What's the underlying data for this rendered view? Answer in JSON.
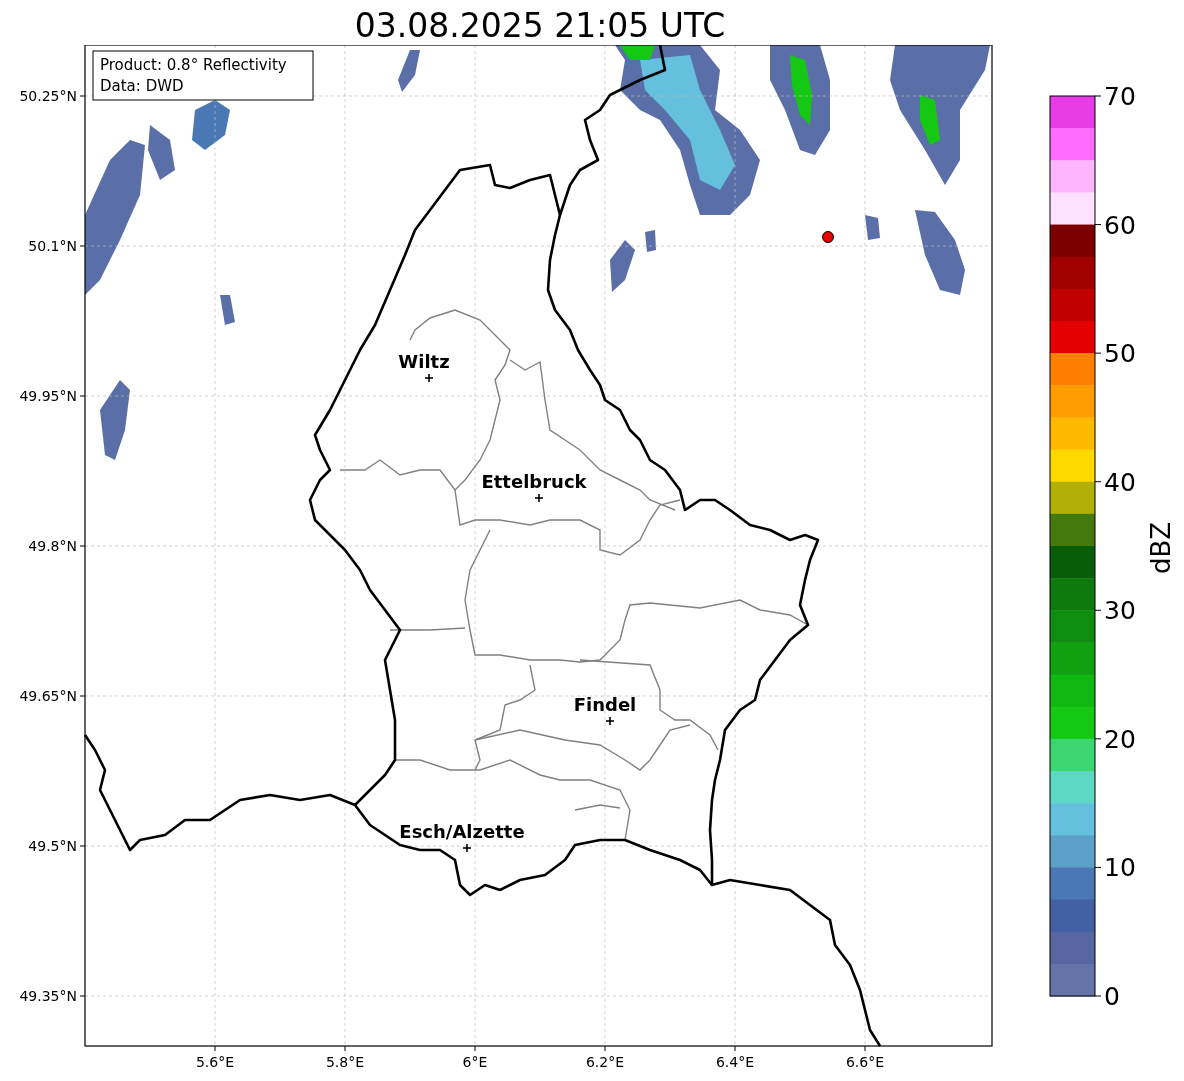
{
  "title": "03.08.2025 21:05 UTC",
  "info_box": {
    "lines": [
      "Product: 0.8° Reflectivity",
      "Data: DWD"
    ]
  },
  "map": {
    "lat_ticks": [
      "50.25°N",
      "50.1°N",
      "49.95°N",
      "49.8°N",
      "49.65°N",
      "49.5°N",
      "49.35°N"
    ],
    "lon_ticks": [
      "5.6°E",
      "5.8°E",
      "6°E",
      "6.2°E",
      "6.4°E",
      "6.6°E"
    ],
    "cities": [
      {
        "name": "Wiltz"
      },
      {
        "name": "Ettelbruck"
      },
      {
        "name": "Findel"
      },
      {
        "name": "Esch/Alzette"
      }
    ]
  },
  "colorbar": {
    "label": "dBZ",
    "ticks": [
      "70",
      "60",
      "50",
      "40",
      "30",
      "20",
      "10",
      "0"
    ],
    "segments": [
      {
        "color": "#e83ce8"
      },
      {
        "color": "#ff6cff"
      },
      {
        "color": "#ffb4ff"
      },
      {
        "color": "#ffe0ff"
      },
      {
        "color": "#7c0000"
      },
      {
        "color": "#a00000"
      },
      {
        "color": "#c00000"
      },
      {
        "color": "#e40000"
      },
      {
        "color": "#ff8000"
      },
      {
        "color": "#ff9c00"
      },
      {
        "color": "#ffb800"
      },
      {
        "color": "#ffd800"
      },
      {
        "color": "#b0b008"
      },
      {
        "color": "#447a0c"
      },
      {
        "color": "#085e08"
      },
      {
        "color": "#0c7a0c"
      },
      {
        "color": "#0e8e10"
      },
      {
        "color": "#10a010"
      },
      {
        "color": "#12b812"
      },
      {
        "color": "#14c814"
      },
      {
        "color": "#3cd670"
      },
      {
        "color": "#5cd8c4"
      },
      {
        "color": "#64c0dc"
      },
      {
        "color": "#5aa0c8"
      },
      {
        "color": "#4a78b4"
      },
      {
        "color": "#4460a4"
      },
      {
        "color": "#5566a0"
      },
      {
        "color": "#6474a8"
      }
    ]
  }
}
